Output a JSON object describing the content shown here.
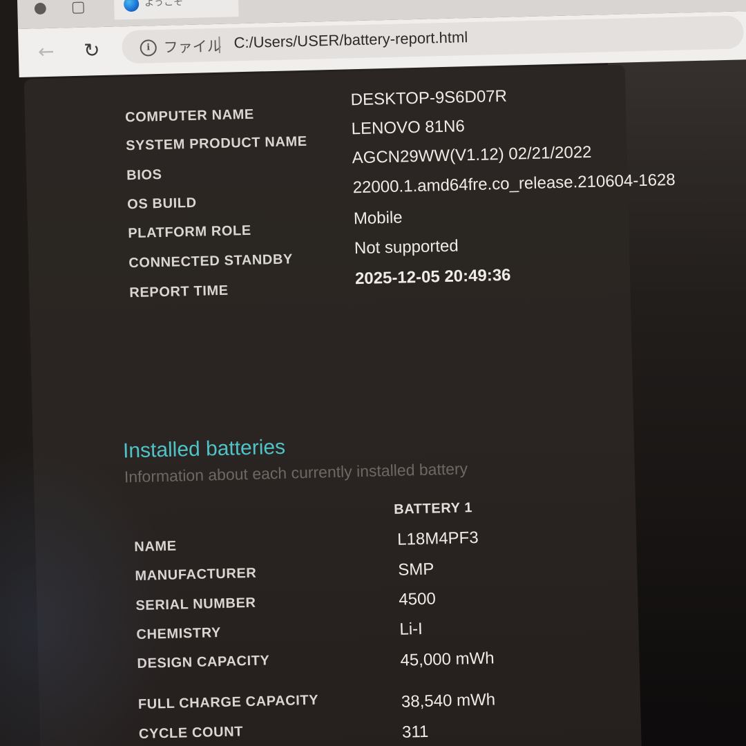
{
  "browser": {
    "tab_title": "ようこそ",
    "address_prefix": "ファイル",
    "url": "C:/Users/USER/battery-report.html"
  },
  "system_info": [
    {
      "label": "COMPUTER NAME",
      "value": "DESKTOP-9S6D07R"
    },
    {
      "label": "SYSTEM PRODUCT NAME",
      "value": "LENOVO 81N6"
    },
    {
      "label": "BIOS",
      "value": "AGCN29WW(V1.12) 02/21/2022"
    },
    {
      "label": "OS BUILD",
      "value": "22000.1.amd64fre.co_release.210604-1628"
    },
    {
      "label": "PLATFORM ROLE",
      "value": "Mobile"
    },
    {
      "label": "CONNECTED STANDBY",
      "value": "Not supported"
    },
    {
      "label": "REPORT TIME",
      "value": "2025-12-05  20:49:36"
    }
  ],
  "installed_batteries": {
    "title": "Installed batteries",
    "subtitle": "Information about each currently installed battery",
    "column_header": "BATTERY 1",
    "rows": [
      {
        "label": "NAME",
        "value": "L18M4PF3"
      },
      {
        "label": "MANUFACTURER",
        "value": "SMP"
      },
      {
        "label": "SERIAL NUMBER",
        "value": "4500"
      },
      {
        "label": "CHEMISTRY",
        "value": "Li-I"
      },
      {
        "label": "DESIGN CAPACITY",
        "value": "45,000 mWh"
      },
      {
        "label": "FULL CHARGE CAPACITY",
        "value": "38,540 mWh"
      },
      {
        "label": "CYCLE COUNT",
        "value": "311"
      }
    ]
  }
}
